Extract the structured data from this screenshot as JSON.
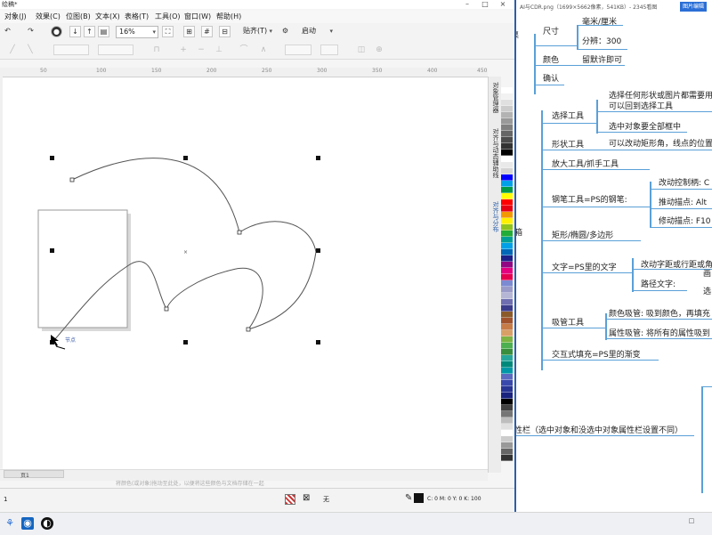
{
  "cdr": {
    "window_title": "绘稿*",
    "menu": [
      "对象(J)",
      "效果(C)",
      "位图(B)",
      "文本(X)",
      "表格(T)",
      "工具(O)",
      "窗口(W)",
      "帮助(H)"
    ],
    "zoom": "16%",
    "snap_label": "贴齐(T)",
    "launch_label": "启动",
    "ruler_ticks": [
      "50",
      "100",
      "150",
      "200",
      "250",
      "300",
      "350",
      "400",
      "450"
    ],
    "docker_tabs": [
      "对象管理器",
      "对齐与动态辅助线",
      "对齐与分布"
    ],
    "node_label": "节点",
    "hint": "将颜色(或对象)拖动至此处，以便将这些颜色与文档存储在一起",
    "page_tab": "页1",
    "status": {
      "left_marker": "1",
      "fill_none": "无",
      "outline_cmyk": "C: 0 M: 0 Y: 0 K: 100"
    },
    "palette_colors": [
      "#ffffff",
      "#f2f2f2",
      "#e0e0e0",
      "#cccccc",
      "#b3b3b3",
      "#999999",
      "#808080",
      "#666666",
      "#4d4d4d",
      "#333333",
      "#000000",
      "#ffffff",
      "#e9e9e9",
      "#d4d4d4",
      "#0000ff",
      "#00a0e9",
      "#009944",
      "#ffff00",
      "#ff0000",
      "#e60012",
      "#f39800",
      "#fff100",
      "#8fc31f",
      "#22ac38",
      "#009e96",
      "#00a0e9",
      "#0068b7",
      "#1d2088",
      "#920783",
      "#e4007f",
      "#e5004f",
      "#7b8ad1",
      "#9a9ac8",
      "#b5b5d6",
      "#6e6eb0",
      "#3c3c8c",
      "#8b5a2b",
      "#a0522d",
      "#c77c48",
      "#d9a066",
      "#7cb342",
      "#4caf50",
      "#388e3c",
      "#26a69a",
      "#00897b",
      "#0097a7",
      "#5c6bc0",
      "#3949ab",
      "#283593",
      "#1a237e",
      "#000000",
      "#424242",
      "#757575",
      "#bdbdbd",
      "#e0e0e0",
      "#ffffff",
      "#cccccc",
      "#999999",
      "#666666",
      "#333333"
    ]
  },
  "viewer": {
    "title": "AI与CDR.png（1699×5662像素，541KB）- 2345看图",
    "edit_button": "图片编辑",
    "nodes": {
      "chicun": "尺寸",
      "haomi": "毫米/厘米",
      "fenbianlv": "分辨：300",
      "yanse": "颜色",
      "moren": "留默许即可",
      "queren": "确认",
      "xuanze": "选择工具",
      "xuanze_d1": "选择任何形状或图片都需要用",
      "xuanze_d2": "可以回到选择工具",
      "xuanze_d3": "选中对象要全部框中",
      "xingzhuang": "形状工具",
      "xingzhuang_d": "可以改动矩形角，线点的位置",
      "fangda": "放大工具/抓手工具",
      "gangbi": "钢笔工具=PS的钢笔:",
      "gangbi_d1": "改动控制柄: C",
      "gangbi_d2": "推动描点: Alt",
      "gangbi_d3": "修动描点: F10",
      "juxing": "矩形/椭圆/多边形",
      "wenzi": "文字=PS里的文字",
      "wenzi_d1": "改动字距或行距或角",
      "wenzi_d2": "路径文字:",
      "wenzi_d3": "画",
      "wenzi_d4": "选",
      "xiguan": "吸管工具",
      "xiguan_d1": "颜色吸管: 吸到颜色，再填充",
      "xiguan_d2": "属性吸管: 将所有的属性吸到",
      "jiaohu": "交互式填充=PS里的渐变",
      "xiangji": "箱",
      "shuxinglan": "性栏（选中对象和没选中对象属性栏设置不同）"
    }
  }
}
